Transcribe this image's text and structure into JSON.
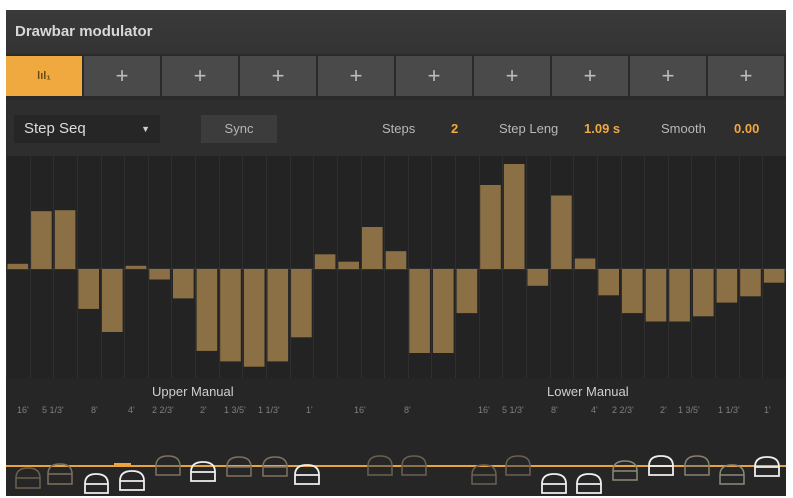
{
  "title": "Drawbar modulator",
  "tabs": [
    {
      "label": "lıl₁",
      "active": true
    },
    {
      "label": "+"
    },
    {
      "label": "+"
    },
    {
      "label": "+"
    },
    {
      "label": "+"
    },
    {
      "label": "+"
    },
    {
      "label": "+"
    },
    {
      "label": "+"
    },
    {
      "label": "+"
    },
    {
      "label": "+"
    }
  ],
  "controls": {
    "mode": "Step Seq",
    "sync": "Sync",
    "steps_label": "Steps",
    "steps_value": "2",
    "step_length_label": "Step Leng",
    "step_length_value": "1.09 s",
    "smooth_label": "Smooth",
    "smooth_value": "0.00"
  },
  "sequencer": {
    "bar_color": "#8b7045",
    "values": [
      0.05,
      0.55,
      0.56,
      -0.38,
      -0.6,
      0.03,
      -0.1,
      -0.28,
      -0.78,
      -0.88,
      -0.93,
      -0.88,
      -0.65,
      0.14,
      0.07,
      0.4,
      0.17,
      -0.8,
      -0.8,
      -0.42,
      0.8,
      1.0,
      -0.16,
      0.7,
      0.1,
      -0.25,
      -0.42,
      -0.5,
      -0.5,
      -0.45,
      -0.32,
      -0.26,
      -0.13
    ]
  },
  "upper_manual": {
    "title": "Upper Manual",
    "footages": [
      "16'",
      "5 1/3'",
      "8'",
      "4'",
      "2 2/3'",
      "2'",
      "1 3/5'",
      "1 1/3'",
      "1'"
    ]
  },
  "lower_manual": {
    "title": "Lower Manual",
    "footages": [
      "16'",
      "5 1/3'",
      "8'",
      "4'",
      "2 2/3'",
      "2'",
      "1 3/5'",
      "1 1/3'",
      "1'"
    ]
  },
  "colors": {
    "accent": "#f0a93f",
    "bar": "#8b7045",
    "handle_dim": "#8a7a62",
    "handle_bright": "#f2f2f2"
  }
}
